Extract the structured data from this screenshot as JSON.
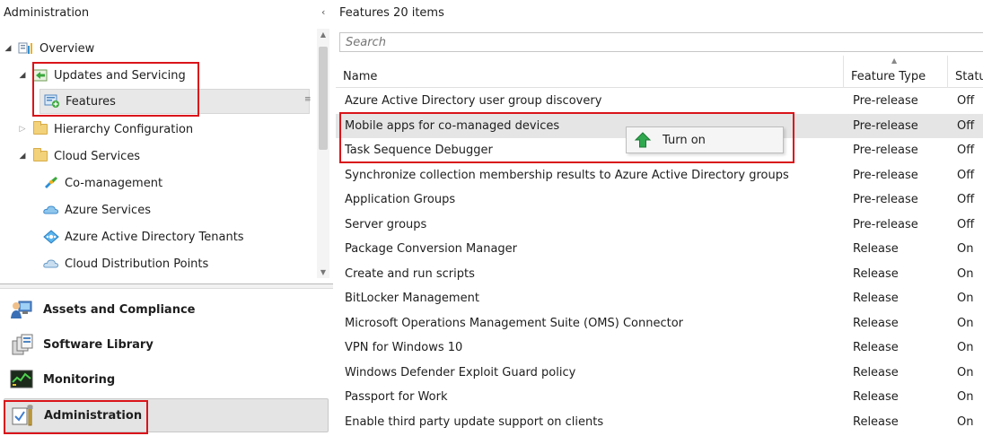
{
  "left_pane": {
    "title": "Administration",
    "collapse_glyph": "‹",
    "tree": {
      "overview": "Overview",
      "updates_and_servicing": "Updates and Servicing",
      "features": "Features",
      "hierarchy_configuration": "Hierarchy Configuration",
      "cloud_services": "Cloud Services",
      "co_management": "Co-management",
      "azure_services": "Azure Services",
      "aad_tenants": "Azure Active Directory Tenants",
      "cloud_distribution_points": "Cloud Distribution Points"
    },
    "workspaces": {
      "assets": "Assets and Compliance",
      "software_library": "Software Library",
      "monitoring": "Monitoring",
      "administration": "Administration"
    }
  },
  "right_pane": {
    "header_title": "Features",
    "header_count": "20 items",
    "search_placeholder": "Search",
    "columns": {
      "name": "Name",
      "feature_type": "Feature Type",
      "status": "Status"
    },
    "rows": [
      {
        "name": "Azure Active Directory user group discovery",
        "type": "Pre-release",
        "status": "Off"
      },
      {
        "name": "Mobile apps for co-managed devices",
        "type": "Pre-release",
        "status": "Off"
      },
      {
        "name": "Task Sequence Debugger",
        "type": "Pre-release",
        "status": "Off"
      },
      {
        "name": "Synchronize collection membership results to Azure Active Directory groups",
        "type": "Pre-release",
        "status": "Off"
      },
      {
        "name": "Application Groups",
        "type": "Pre-release",
        "status": "Off"
      },
      {
        "name": "Server groups",
        "type": "Pre-release",
        "status": "Off"
      },
      {
        "name": "Package Conversion Manager",
        "type": "Release",
        "status": "On"
      },
      {
        "name": "Create and run scripts",
        "type": "Release",
        "status": "On"
      },
      {
        "name": "BitLocker Management",
        "type": "Release",
        "status": "On"
      },
      {
        "name": "Microsoft Operations Management Suite (OMS) Connector",
        "type": "Release",
        "status": "On"
      },
      {
        "name": "VPN for Windows 10",
        "type": "Release",
        "status": "On"
      },
      {
        "name": "Windows Defender Exploit Guard policy",
        "type": "Release",
        "status": "On"
      },
      {
        "name": "Passport for Work",
        "type": "Release",
        "status": "On"
      },
      {
        "name": "Enable third party update support on clients",
        "type": "Release",
        "status": "On"
      }
    ]
  },
  "context_menu": {
    "turn_on": "Turn on"
  },
  "colors": {
    "annotation_red": "#d9141a",
    "selection_gray": "#e5e5e5",
    "turn_on_green": "#2fa84f"
  }
}
